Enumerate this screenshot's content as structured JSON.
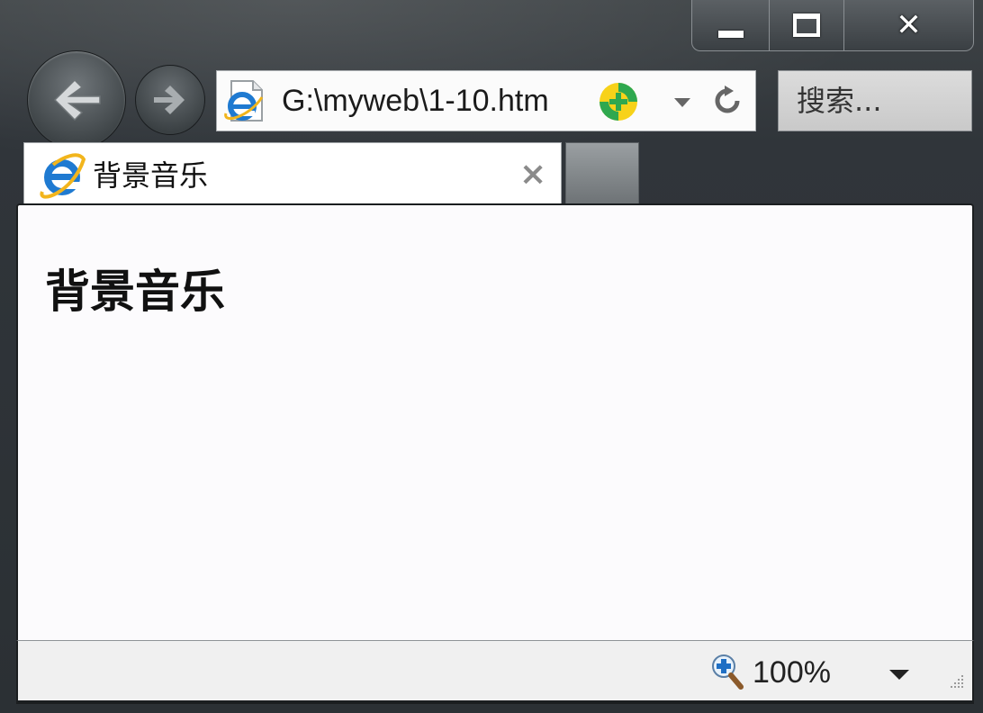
{
  "window": {
    "caption_buttons": [
      "minimize",
      "maximize",
      "close"
    ]
  },
  "toolbar": {
    "address": "G:\\myweb\\1-10.htm",
    "search_placeholder": "搜索..."
  },
  "tab": {
    "title": "背景音乐"
  },
  "page": {
    "heading": "背景音乐"
  },
  "status": {
    "zoom": "100%"
  },
  "icons": [
    "back-arrow-icon",
    "forward-arrow-icon",
    "ie-logo-icon",
    "add-favorite-icon",
    "dropdown-icon",
    "refresh-icon",
    "tab-close-icon",
    "zoom-icon",
    "resize-grip-icon"
  ],
  "colors": {
    "chrome_dark": "#2b3034",
    "content_bg": "#fcfbfd",
    "ie_blue": "#1f7ad1",
    "ie_gold": "#f2b51c"
  }
}
